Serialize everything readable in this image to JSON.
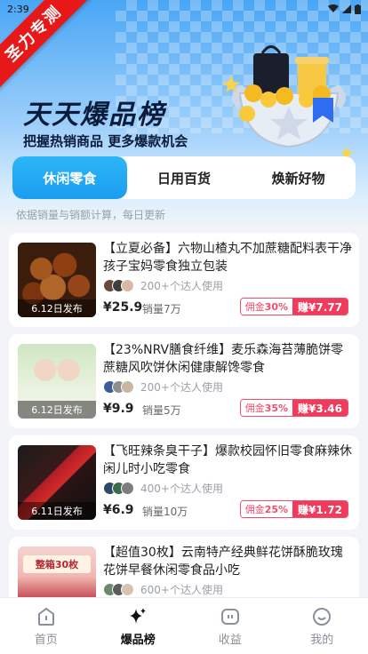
{
  "status_bar": {
    "time": "2:39"
  },
  "ribbon": {
    "text": "圣力专测"
  },
  "header": {
    "title": "天天爆品榜",
    "subtitle": "把握热销商品 更多爆款机会"
  },
  "tabs": [
    {
      "label": "休闲零食",
      "active": true
    },
    {
      "label": "日用百货",
      "active": false
    },
    {
      "label": "焕新好物",
      "active": false
    }
  ],
  "hint": "依据销量与销额计算，每日更新",
  "products": [
    {
      "title": "【立夏必备】六物山楂丸不加蔗糖配料表干净孩子宝妈零食独立包装",
      "date": "6.12日发布",
      "users": "200+个达人使用",
      "price": "¥25.9",
      "sales": "销量7万",
      "commission_label": "佣金",
      "commission_rate": "30%",
      "earn": "赚¥7.77"
    },
    {
      "title": "【23%NRV膳食纤维】麦乐森海苔薄脆饼零蔗糖风吹饼休闲健康解馋零食",
      "date": "6.12日发布",
      "users": "200+个达人使用",
      "price": "¥9.9",
      "sales": "销量5万",
      "commission_label": "佣金",
      "commission_rate": "35%",
      "earn": "赚¥3.46"
    },
    {
      "title": "【飞旺辣条臭干子】爆款校园怀旧零食麻辣休闲儿时小吃零食",
      "date": "6.11日发布",
      "users": "400+个达人使用",
      "price": "¥6.9",
      "sales": "销量10万",
      "commission_label": "佣金",
      "commission_rate": "25%",
      "earn": "赚¥1.72"
    },
    {
      "title": "【超值30枚】云南特产经典鲜花饼酥脆玫瑰花饼早餐休闲零食品小吃",
      "date": "",
      "users": "600+个达人使用",
      "price": "",
      "sales": "",
      "commission_label": "",
      "commission_rate": "",
      "earn": "",
      "thumb_text": "整箱30枚"
    }
  ],
  "bottom_nav": [
    {
      "label": "首页",
      "icon": "home-icon",
      "active": false
    },
    {
      "label": "爆品榜",
      "icon": "sparkle-icon",
      "active": true
    },
    {
      "label": "收益",
      "icon": "wallet-icon",
      "active": false
    },
    {
      "label": "我的",
      "icon": "smile-icon",
      "active": false
    }
  ],
  "colors": {
    "accent": "#1c9df0",
    "commission": "#f03b5c",
    "ribbon": "#e81818"
  }
}
